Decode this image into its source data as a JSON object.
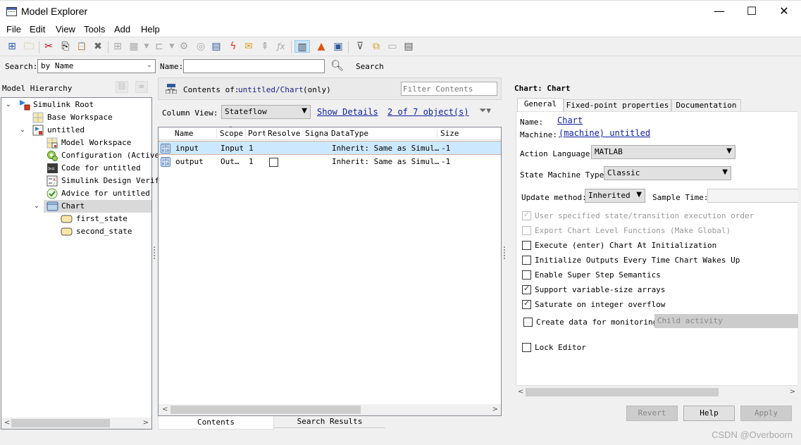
{
  "window": {
    "title": "Model Explorer",
    "controls": {
      "minimize": "—",
      "maximize": "☐",
      "close": "✕"
    }
  },
  "menu": [
    "File",
    "Edit",
    "View",
    "Tools",
    "Add",
    "Help"
  ],
  "toolbar": {
    "icons": [
      {
        "name": "add-model-icon",
        "glyph": "⊞",
        "enabled": true
      },
      {
        "name": "open-folder-icon",
        "glyph": "🗀",
        "enabled": true
      },
      {
        "name": "cut-icon",
        "glyph": "✂",
        "enabled": true
      },
      {
        "name": "copy-icon",
        "glyph": "⎘",
        "enabled": true
      },
      {
        "name": "paste-icon",
        "glyph": "📋",
        "enabled": false
      },
      {
        "name": "delete-icon",
        "glyph": "✖",
        "enabled": true
      },
      {
        "name": "grid-icon",
        "glyph": "⊞",
        "enabled": false
      },
      {
        "name": "data-dropdown-icon",
        "glyph": "▦",
        "enabled": false
      },
      {
        "name": "bus-dropdown-icon",
        "glyph": "⊏",
        "enabled": false
      },
      {
        "name": "config-icon",
        "glyph": "⚙",
        "enabled": false
      },
      {
        "name": "settings-icon",
        "glyph": "◎",
        "enabled": false
      },
      {
        "name": "add-data-icon",
        "glyph": "▤",
        "enabled": true
      },
      {
        "name": "add-event-icon",
        "glyph": "ϟ",
        "enabled": true
      },
      {
        "name": "add-message-icon",
        "glyph": "✉",
        "enabled": true
      },
      {
        "name": "add-function-icon",
        "glyph": "⇞",
        "enabled": false
      },
      {
        "name": "fx-icon",
        "glyph": "ƒx",
        "enabled": false
      },
      {
        "name": "column-view-icon",
        "glyph": "▥",
        "enabled": true
      },
      {
        "name": "matlab-icon",
        "glyph": "▲",
        "enabled": true
      },
      {
        "name": "dashboard-icon",
        "glyph": "▣",
        "enabled": true
      },
      {
        "name": "filter-icon",
        "glyph": "⊽",
        "enabled": true
      },
      {
        "name": "link-icon",
        "glyph": "⧉",
        "enabled": true
      },
      {
        "name": "view-icon",
        "glyph": "▭",
        "enabled": false
      },
      {
        "name": "report-icon",
        "glyph": "▤",
        "enabled": true
      }
    ]
  },
  "search": {
    "label": "Search:",
    "by_value": "by Name",
    "name_label": "Name:",
    "name_value": "",
    "button_label": "Search"
  },
  "hierarchy": {
    "title": "Model Hierarchy",
    "items": [
      {
        "label": "Simulink Root",
        "level": 0,
        "expanded": true,
        "icon": "simulink-root-icon"
      },
      {
        "label": "Base Workspace",
        "level": 1,
        "icon": "workspace-icon"
      },
      {
        "label": "untitled",
        "level": 1,
        "expanded": true,
        "icon": "model-icon"
      },
      {
        "label": "Model Workspace",
        "level": 2,
        "icon": "model-workspace-icon"
      },
      {
        "label": "Configuration (Active)",
        "level": 2,
        "icon": "configuration-icon"
      },
      {
        "label": "Code for untitled",
        "level": 2,
        "icon": "code-icon"
      },
      {
        "label": "Simulink Design Verifier",
        "level": 2,
        "icon": "design-verifier-icon"
      },
      {
        "label": "Advice for untitled",
        "level": 2,
        "icon": "advice-icon"
      },
      {
        "label": "Chart",
        "level": 2,
        "expanded": true,
        "selected": true,
        "icon": "chart-icon"
      },
      {
        "label": "first_state",
        "level": 3,
        "icon": "state-icon"
      },
      {
        "label": "second_state",
        "level": 3,
        "icon": "state-icon"
      }
    ]
  },
  "contents": {
    "prefix": "Contents of:",
    "path": "untitled/Chart",
    "suffix": "(only)",
    "filter_placeholder": "Filter Contents",
    "column_view_label": "Column View:",
    "column_view_value": "Stateflow",
    "show_details": "Show Details",
    "object_count": "2 of 7 object(s)",
    "columns": [
      "Name",
      "Scope",
      "Port",
      "Resolve Signal",
      "DataType",
      "Size"
    ],
    "rows": [
      {
        "name": "input",
        "scope": "Input",
        "port": "1",
        "resolve": null,
        "datatype": "Inherit: Same as Simul…",
        "size": "-1",
        "selected": true
      },
      {
        "name": "output",
        "scope": "Out…",
        "port": "1",
        "resolve": false,
        "datatype": "Inherit: Same as Simul…",
        "size": "-1",
        "selected": false
      }
    ],
    "tabs": [
      "Contents",
      "Search Results"
    ]
  },
  "properties": {
    "header": "Chart: Chart",
    "tabs": [
      "General",
      "Fixed-point properties",
      "Documentation"
    ],
    "name_label": "Name:",
    "name_value": "Chart",
    "machine_label": "Machine:",
    "machine_value": "(machine) untitled",
    "action_language_label": "Action Language:",
    "action_language_value": "MATLAB",
    "state_machine_type_label": "State Machine Type:",
    "state_machine_type_value": "Classic",
    "update_method_label": "Update method:",
    "update_method_value": "Inherited",
    "sample_time_label": "Sample Time:",
    "sample_time_value": "",
    "checkboxes": [
      {
        "label": "User specified state/transition execution order",
        "checked": true,
        "enabled": false
      },
      {
        "label": "Export Chart Level Functions (Make Global)",
        "checked": false,
        "enabled": false
      },
      {
        "label": "Execute (enter) Chart At Initialization",
        "checked": false,
        "enabled": true
      },
      {
        "label": "Initialize Outputs Every Time Chart Wakes Up",
        "checked": false,
        "enabled": true
      },
      {
        "label": "Enable Super Step Semantics",
        "checked": false,
        "enabled": true
      },
      {
        "label": "Support variable-size arrays",
        "checked": true,
        "enabled": true
      },
      {
        "label": "Saturate on integer overflow",
        "checked": true,
        "enabled": true
      }
    ],
    "monitoring_label": "Create data for monitoring:",
    "monitoring_checked": false,
    "monitoring_value": "Child activity",
    "lock_editor_label": "Lock Editor",
    "lock_editor_checked": false,
    "buttons": {
      "revert": "Revert",
      "help": "Help",
      "apply": "Apply"
    }
  },
  "watermark": "CSDN @Overboorn"
}
